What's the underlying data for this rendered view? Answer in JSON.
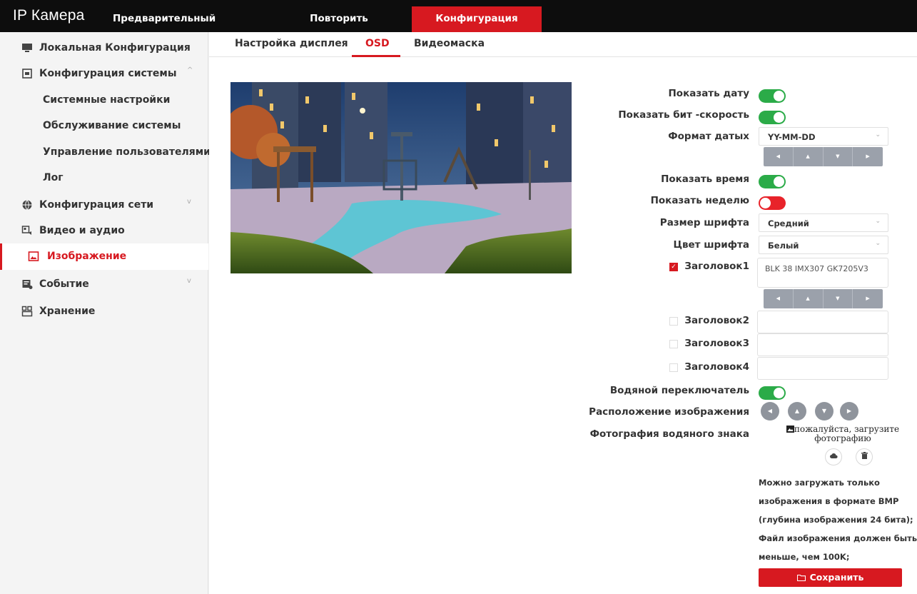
{
  "app": {
    "brand": "IP Камера"
  },
  "topnav": [
    {
      "label": "Предварительный просмотр"
    },
    {
      "label": "Повторить"
    },
    {
      "label": "Конфигурация"
    }
  ],
  "sidebar": {
    "items": [
      {
        "label": "Локальная Конфигурация",
        "icon": "monitor-icon"
      },
      {
        "label": "Конфигурация системы",
        "icon": "system-config-icon",
        "chevron": "^"
      },
      {
        "label": "Системные настройки"
      },
      {
        "label": "Обслуживание системы"
      },
      {
        "label": "Управление пользователями"
      },
      {
        "label": "Лог"
      },
      {
        "label": "Конфигурация сети",
        "icon": "globe-icon",
        "chevron": "v"
      },
      {
        "label": "Видео и аудио",
        "icon": "video-audio-icon"
      },
      {
        "label": "Изображение",
        "icon": "image-icon"
      },
      {
        "label": "Событие",
        "icon": "event-icon",
        "chevron": "v"
      },
      {
        "label": "Хранение",
        "icon": "storage-icon"
      }
    ]
  },
  "subtabs": [
    {
      "label": "Настройка дисплея"
    },
    {
      "label": "OSD"
    },
    {
      "label": "Видеомаска"
    }
  ],
  "osd": {
    "show_date_label": "Показать дату",
    "show_date": true,
    "show_bitrate_label": "Показать бит -скорость",
    "show_bitrate": true,
    "date_format_label": "Формат датых",
    "date_format_value": "YY-MM-DD",
    "show_time_label": "Показать время",
    "show_time": true,
    "show_week_label": "Показать неделю",
    "show_week": false,
    "font_size_label": "Размер шрифта",
    "font_size_value": "Средний",
    "font_color_label": "Цвет шрифта",
    "font_color_value": "Белый",
    "title1_label": "Заголовок1",
    "title1_checked": true,
    "title1_value": "BLK 38 IMX307 GK7205V3",
    "title2_label": "Заголовок2",
    "title2_value": "",
    "title3_label": "Заголовок3",
    "title3_value": "",
    "title4_label": "Заголовок4",
    "title4_value": "",
    "watermark_label": "Водяной переключатель",
    "watermark": true,
    "image_position_label": "Расположение изображения",
    "watermark_photo_label": "Фотография водяного знака",
    "upload_placeholder": "пожалуйста, загрузите фотографию",
    "note_lines": [
      " Можно загружать только",
      "изображения в формате BMP",
      "(глубина изображения 24 бита);",
      " Файл изображения должен быть",
      "меньше, чем 100K;"
    ],
    "save_label": "Сохранить"
  },
  "colors": {
    "accent": "#d71920",
    "toggle_on": "#2bab48",
    "toggle_off": "#e8232a",
    "topbar": "#0d0d0d"
  }
}
